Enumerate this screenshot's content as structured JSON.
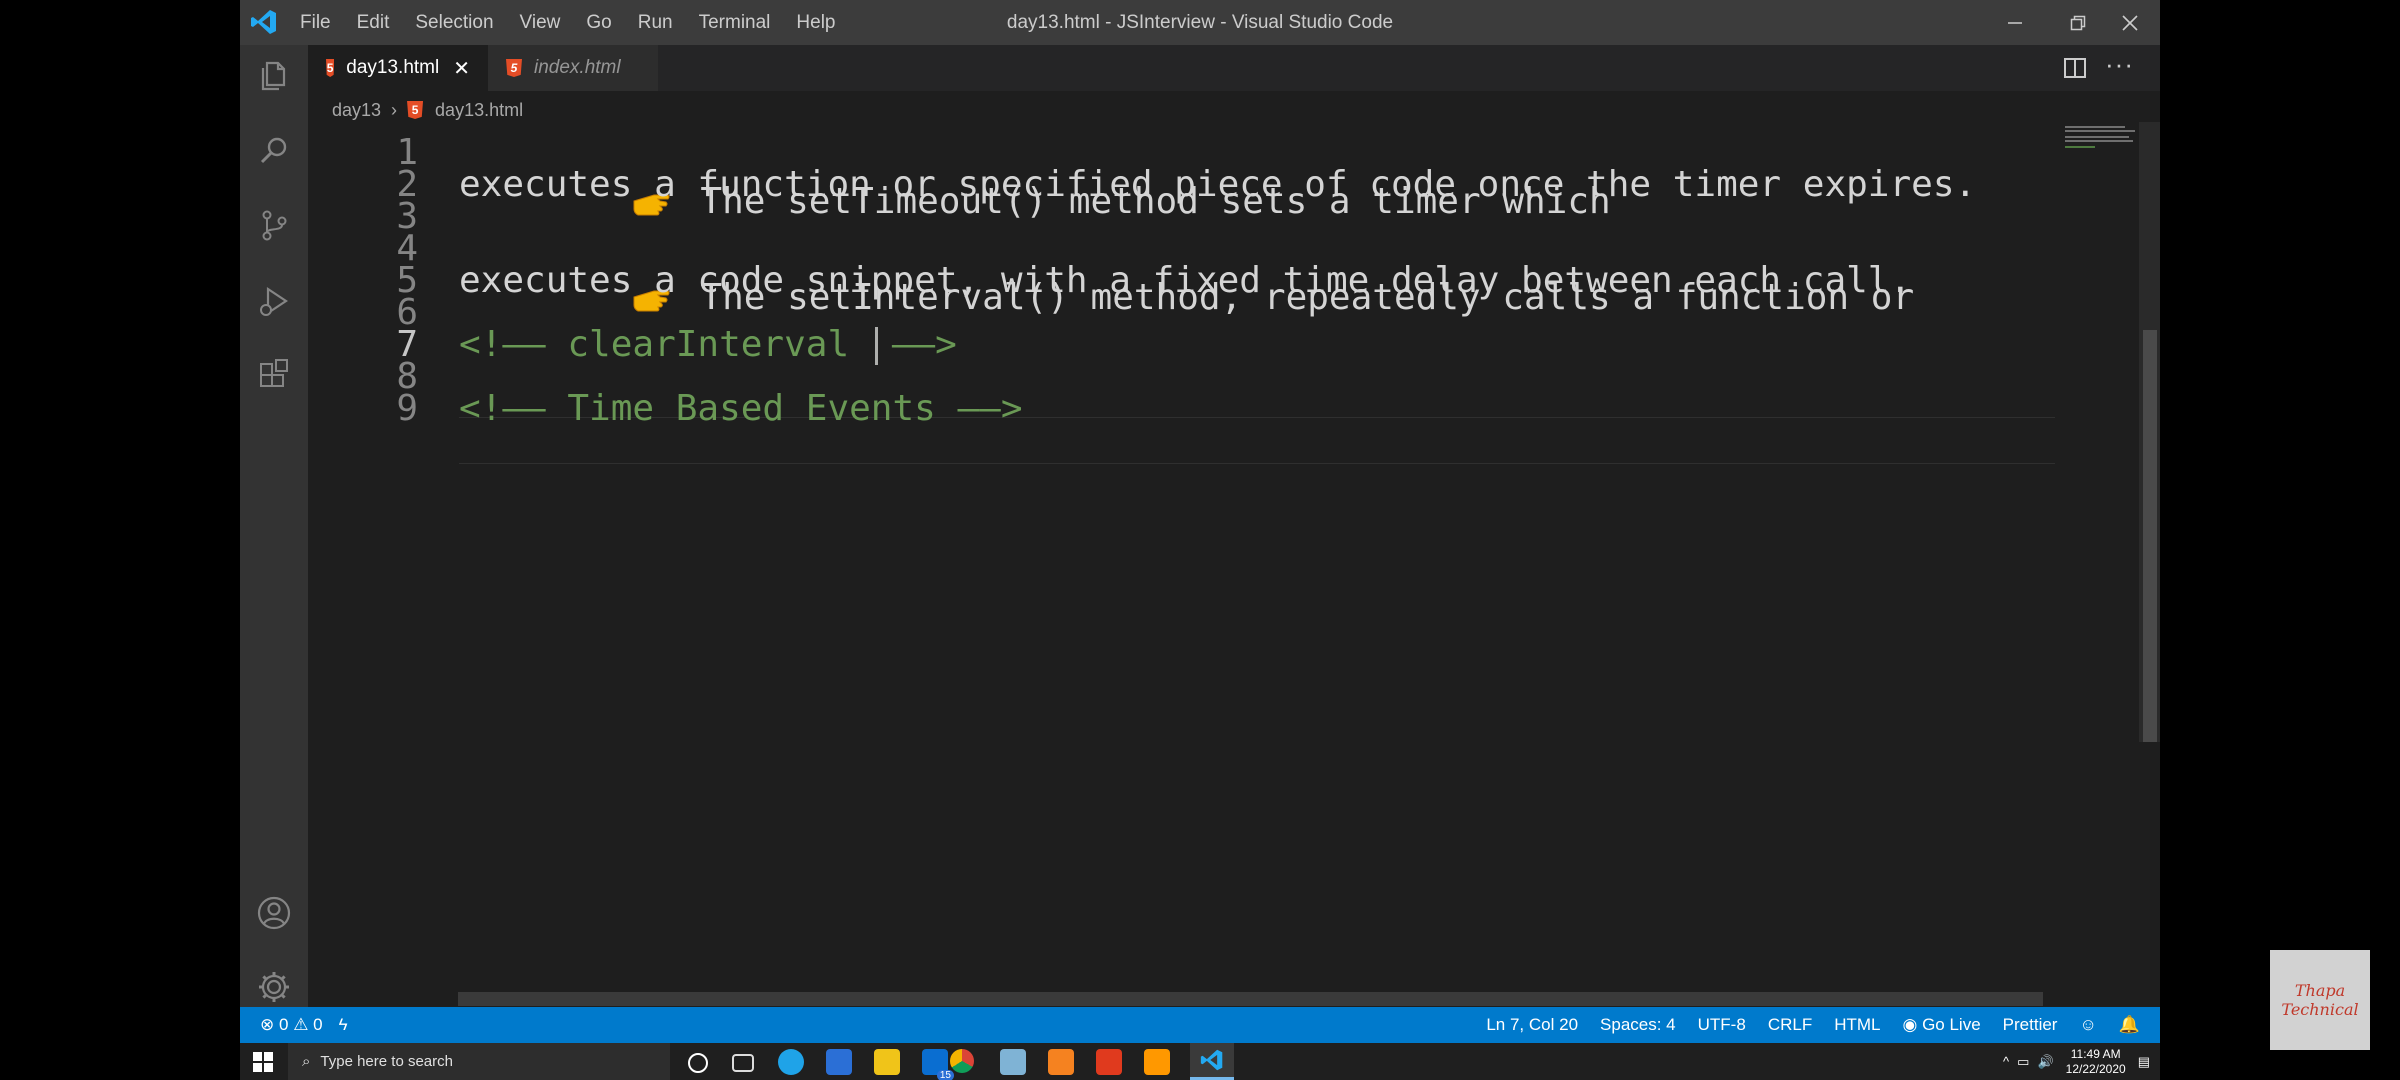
{
  "titlebar": {
    "menu": [
      "File",
      "Edit",
      "Selection",
      "View",
      "Go",
      "Run",
      "Terminal",
      "Help"
    ],
    "title": "day13.html - JSInterview - Visual Studio Code"
  },
  "tabs": [
    {
      "label": "day13.html",
      "active": true
    },
    {
      "label": "index.html",
      "active": false
    }
  ],
  "breadcrumb": {
    "folder": "day13",
    "file": "day13.html"
  },
  "editor": {
    "lines": [
      {
        "num": "1",
        "text": "The setTimeout() method sets a timer which"
      },
      {
        "num": "2",
        "text": "executes a function or specified piece of code once the timer expires."
      },
      {
        "num": "3",
        "text": ""
      },
      {
        "num": "4",
        "text": "The setInterval() method, repeatedly calls a function or"
      },
      {
        "num": "5",
        "text": "executes a code snippet, with a fixed time delay between each call."
      },
      {
        "num": "6",
        "text": ""
      },
      {
        "num": "7",
        "before": "<!—— clearInterval",
        "after": "——>"
      },
      {
        "num": "8",
        "text": ""
      },
      {
        "num": "9",
        "text": "<!—— Time Based Events ——>"
      }
    ]
  },
  "statusbar": {
    "errors": "0",
    "warnings": "0",
    "position": "Ln 7, Col 20",
    "spaces": "Spaces: 4",
    "encoding": "UTF-8",
    "eol": "CRLF",
    "language": "HTML",
    "golive": "Go Live",
    "prettier": "Prettier"
  },
  "taskbar": {
    "search_placeholder": "Type here to search",
    "mail_badge": "15",
    "time": "11:49 AM",
    "date": "12/22/2020"
  },
  "watermark": {
    "line1": "Thapa",
    "line2": "Technical"
  },
  "colors": {
    "accent": "#007acc",
    "comment": "#6a9955",
    "html_icon": "#e44d26"
  }
}
